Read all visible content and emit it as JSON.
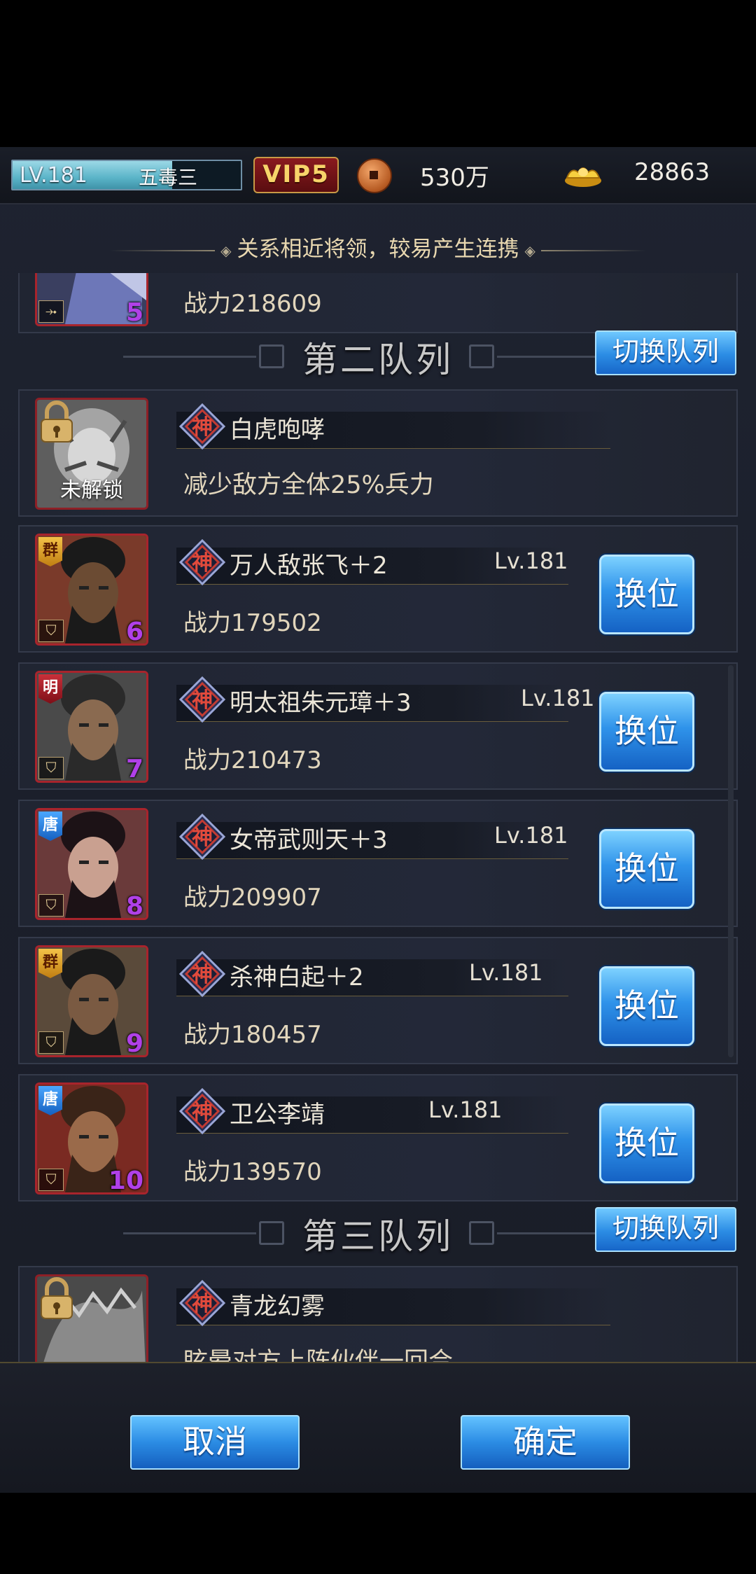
{
  "topbar": {
    "level": "LV.181",
    "name": "五毒三",
    "level_progress": 0.7,
    "vip": "VIP5",
    "coins": "530万",
    "gold": "28863"
  },
  "hint": "关系相近将领，较易产生连携",
  "partial_top_card": {
    "slot": "5",
    "power": "战力218609"
  },
  "sections": [
    {
      "title": "第二队列",
      "switch_label": "切换队列"
    },
    {
      "title": "第三队列",
      "switch_label": "切换队列"
    }
  ],
  "skills": [
    {
      "name": "白虎咆哮",
      "desc": "减少敌方全体25%兵力",
      "lock_label": "未解锁",
      "badge": "神"
    },
    {
      "name": "青龙幻雾",
      "desc": "眩晕对方上阵伙伴一回合",
      "badge": "神"
    }
  ],
  "generals": [
    {
      "faction": "群",
      "name": "万人敌张飞＋2",
      "level": "Lv.181",
      "power": "战力179502",
      "slot": "6",
      "badge": "神",
      "button": "换位"
    },
    {
      "faction": "明",
      "name": "明太祖朱元璋＋3",
      "level": "Lv.181",
      "power": "战力210473",
      "slot": "7",
      "badge": "神",
      "button": "换位"
    },
    {
      "faction": "唐",
      "name": "女帝武则天＋3",
      "level": "Lv.181",
      "power": "战力209907",
      "slot": "8",
      "badge": "神",
      "button": "换位"
    },
    {
      "faction": "群",
      "name": "杀神白起＋2",
      "level": "Lv.181",
      "power": "战力180457",
      "slot": "9",
      "badge": "神",
      "button": "换位"
    },
    {
      "faction": "唐",
      "name": "卫公李靖",
      "level": "Lv.181",
      "power": "战力139570",
      "slot": "10",
      "badge": "神",
      "button": "换位"
    }
  ],
  "footer": {
    "cancel": "取消",
    "confirm": "确定"
  },
  "colors": {
    "accent_blue": "#2b8ce4",
    "frame_red": "#a8242c",
    "slot_purple": "#b040e8"
  }
}
